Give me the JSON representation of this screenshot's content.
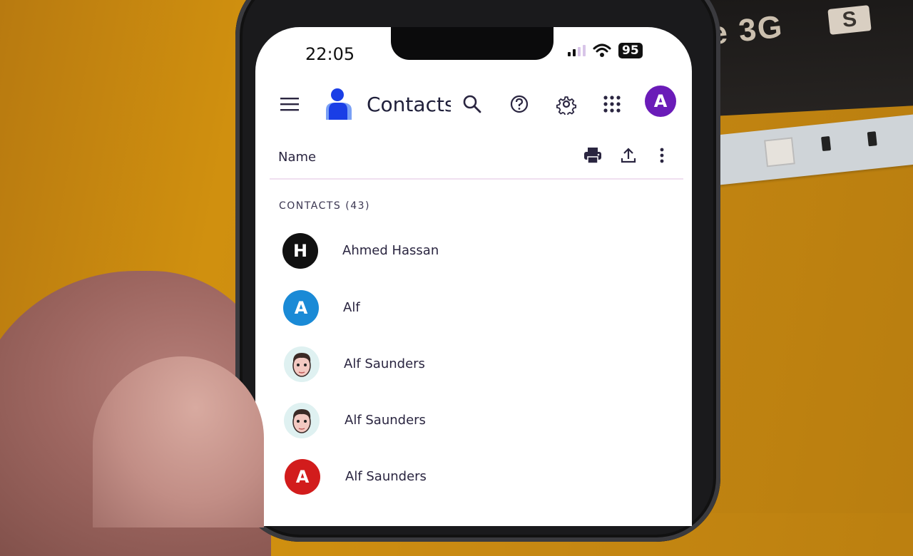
{
  "background": {
    "box_text": "e 3G",
    "box_badge": "S"
  },
  "status_bar": {
    "time": "22:05",
    "battery": "95",
    "signal_bars_active": 2,
    "signal_bars_total": 4
  },
  "app_bar": {
    "menu_icon": "hamburger-menu-icon",
    "logo_icon": "contacts-person-icon",
    "title": "Contacts",
    "actions": [
      {
        "name": "search",
        "icon": "search-icon"
      },
      {
        "name": "help",
        "icon": "help-icon"
      },
      {
        "name": "settings",
        "icon": "gear-icon"
      },
      {
        "name": "apps",
        "icon": "apps-grid-icon"
      }
    ],
    "account_initial": "A",
    "account_color": "#6a1bb8"
  },
  "list_header": {
    "column_label": "Name",
    "actions": [
      {
        "name": "print",
        "icon": "print-icon"
      },
      {
        "name": "export",
        "icon": "upload-icon"
      },
      {
        "name": "more",
        "icon": "more-vert-icon"
      }
    ]
  },
  "section": {
    "label": "CONTACTS (43)"
  },
  "contacts": [
    {
      "name": "Ahmed Hassan",
      "initial": "H",
      "avatar_type": "initial",
      "color": "#111111"
    },
    {
      "name": "Alf",
      "initial": "A",
      "avatar_type": "initial",
      "color": "#1a8ad6"
    },
    {
      "name": "Alf Saunders",
      "initial": "",
      "avatar_type": "memoji",
      "color": "#dff1f1"
    },
    {
      "name": "Alf Saunders",
      "initial": "",
      "avatar_type": "memoji",
      "color": "#dff1f1"
    },
    {
      "name": "Alf Saunders",
      "initial": "A",
      "avatar_type": "initial",
      "color": "#d21c1c"
    }
  ],
  "colors": {
    "brand_blue": "#1a3ee6",
    "text": "#2a2540"
  }
}
